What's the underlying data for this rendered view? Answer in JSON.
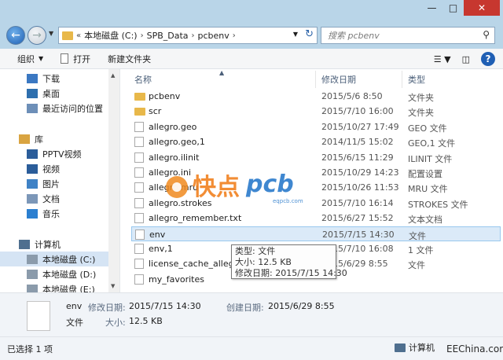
{
  "window": {
    "controls": {
      "minimize": "—",
      "maximize": "□",
      "close": "✕"
    }
  },
  "address": {
    "prefix": "«",
    "parts": [
      "本地磁盘 (C:)",
      "SPB_Data",
      "pcbenv"
    ],
    "separator": "›"
  },
  "search": {
    "placeholder": "搜索 pcbenv"
  },
  "toolbar": {
    "organize": "组织",
    "open": "打开",
    "new_folder": "新建文件夹"
  },
  "sidebar": {
    "items": [
      {
        "label": "下载",
        "icon": "download-icon",
        "color": "#3b78c2"
      },
      {
        "label": "桌面",
        "icon": "desktop-icon",
        "color": "#2e6fae"
      },
      {
        "label": "最近访问的位置",
        "icon": "recent-places-icon",
        "color": "#6d8fb8"
      },
      {
        "label": "库",
        "icon": "library-icon",
        "color": "#d9a441"
      },
      {
        "label": "PPTV视频",
        "icon": "video-library-icon",
        "color": "#2b5d9a"
      },
      {
        "label": "视频",
        "icon": "video-library-icon",
        "color": "#2b5d9a"
      },
      {
        "label": "图片",
        "icon": "pictures-library-icon",
        "color": "#3f82c6"
      },
      {
        "label": "文档",
        "icon": "documents-library-icon",
        "color": "#7c97b8"
      },
      {
        "label": "音乐",
        "icon": "music-library-icon",
        "color": "#2b7fd0"
      },
      {
        "label": "计算机",
        "icon": "computer-icon",
        "color": "#4f6f8f"
      },
      {
        "label": "本地磁盘 (C:)",
        "icon": "drive-icon",
        "color": "#8b9bab"
      },
      {
        "label": "本地磁盘 (D:)",
        "icon": "drive-icon",
        "color": "#8b9bab"
      },
      {
        "label": "本地磁盘 (E:)",
        "icon": "drive-icon",
        "color": "#8b9bab"
      }
    ]
  },
  "columns": {
    "name": "名称",
    "date": "修改日期",
    "type": "类型"
  },
  "files": [
    {
      "name": "pcbenv",
      "date": "2015/5/6 8:50",
      "type": "文件夹",
      "kind": "folder"
    },
    {
      "name": "scr",
      "date": "2015/7/10 16:00",
      "type": "文件夹",
      "kind": "folder"
    },
    {
      "name": "allegro.geo",
      "date": "2015/10/27 17:49",
      "type": "GEO 文件",
      "kind": "file"
    },
    {
      "name": "allegro.geo,1",
      "date": "2014/11/5 15:02",
      "type": "GEO,1 文件",
      "kind": "file"
    },
    {
      "name": "allegro.ilinit",
      "date": "2015/6/15 11:29",
      "type": "ILINIT 文件",
      "kind": "file"
    },
    {
      "name": "allegro.ini",
      "date": "2015/10/29 14:23",
      "type": "配置设置",
      "kind": "file"
    },
    {
      "name": "allegro.mru",
      "date": "2015/10/26 11:53",
      "type": "MRU 文件",
      "kind": "file"
    },
    {
      "name": "allegro.strokes",
      "date": "2015/7/10 16:14",
      "type": "STROKES 文件",
      "kind": "file"
    },
    {
      "name": "allegro_remember.txt",
      "date": "2015/6/27 15:52",
      "type": "文本文档",
      "kind": "file"
    },
    {
      "name": "env",
      "date": "2015/7/15 14:30",
      "type": "文件",
      "kind": "file"
    },
    {
      "name": "env,1",
      "date": "2015/7/10 16:08",
      "type": "1 文件",
      "kind": "file"
    },
    {
      "name": "license_cache_allegro",
      "date": "2015/6/29 8:55",
      "type": "文件",
      "kind": "file"
    },
    {
      "name": "my_favorites",
      "date": "",
      "type": "",
      "kind": "file"
    }
  ],
  "tooltip": {
    "line1": "类型: 文件",
    "line2": "大小: 12.5 KB",
    "line3": "修改日期: 2015/7/15 14:30"
  },
  "watermark": {
    "cn": "快点",
    "en": "pcb",
    "url": "eqpcb.com"
  },
  "details": {
    "name": "env",
    "modified_label": "修改日期:",
    "modified_value": "2015/7/15 14:30",
    "created_label": "创建日期:",
    "created_value": "2015/6/29 8:55",
    "type": "文件",
    "size_label": "大小:",
    "size_value": "12.5 KB"
  },
  "status": {
    "selection": "已选择 1 项",
    "location": "计算机",
    "brand": "EEChina.com"
  }
}
